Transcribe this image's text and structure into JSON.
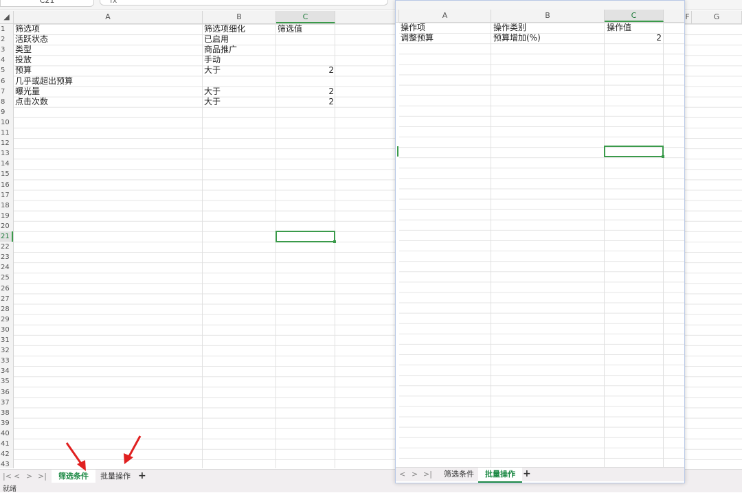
{
  "formula_bar": {
    "name_box": "C21",
    "fx_label": "fx"
  },
  "left_sheet": {
    "columns": [
      "A",
      "B",
      "C"
    ],
    "right_columns": [
      "F",
      "G"
    ],
    "rows": [
      {
        "n": "1",
        "a": "筛选项",
        "b": "筛选项细化",
        "c": "筛选值"
      },
      {
        "n": "2",
        "a": "活跃状态",
        "b": "已启用",
        "c": ""
      },
      {
        "n": "3",
        "a": "类型",
        "b": "商品推广",
        "c": ""
      },
      {
        "n": "4",
        "a": "投放",
        "b": "手动",
        "c": ""
      },
      {
        "n": "5",
        "a": "预算",
        "b": "大于",
        "c": "2"
      },
      {
        "n": "6",
        "a": "几乎或超出预算",
        "b": "",
        "c": ""
      },
      {
        "n": "7",
        "a": "曝光量",
        "b": "大于",
        "c": "2"
      },
      {
        "n": "8",
        "a": "点击次数",
        "b": "大于",
        "c": "2"
      }
    ],
    "row_numbers": [
      "1",
      "2",
      "3",
      "4",
      "5",
      "6",
      "7",
      "8",
      "9",
      "10",
      "11",
      "12",
      "13",
      "14",
      "15",
      "16",
      "17",
      "18",
      "19",
      "20",
      "21",
      "22",
      "23",
      "24",
      "25",
      "26",
      "27",
      "28",
      "29",
      "30",
      "31",
      "32",
      "33",
      "34",
      "35",
      "36",
      "37",
      "38",
      "39",
      "40",
      "41",
      "42",
      "43"
    ],
    "tabs": [
      {
        "label": "筛选条件",
        "active": true
      },
      {
        "label": "批量操作",
        "active": false
      }
    ],
    "add_tab": "+",
    "nav": [
      "|<",
      "<",
      ">",
      ">|"
    ],
    "status_text": "就绪"
  },
  "right_sheet": {
    "columns": [
      "A",
      "B",
      "C"
    ],
    "rows": [
      {
        "a": "操作项",
        "b": "操作类别",
        "c": "操作值"
      },
      {
        "a": "调整预算",
        "b": "预算增加(%)",
        "c": "2"
      }
    ],
    "tabs": [
      {
        "label": "筛选条件",
        "active": false
      },
      {
        "label": "批量操作",
        "active": true
      }
    ],
    "add_tab": "+",
    "nav": [
      "<",
      ">",
      ">|"
    ]
  },
  "colors": {
    "accent": "#1e8a46",
    "selection": "#3a9a4a",
    "annotation_arrow": "#e02020"
  }
}
